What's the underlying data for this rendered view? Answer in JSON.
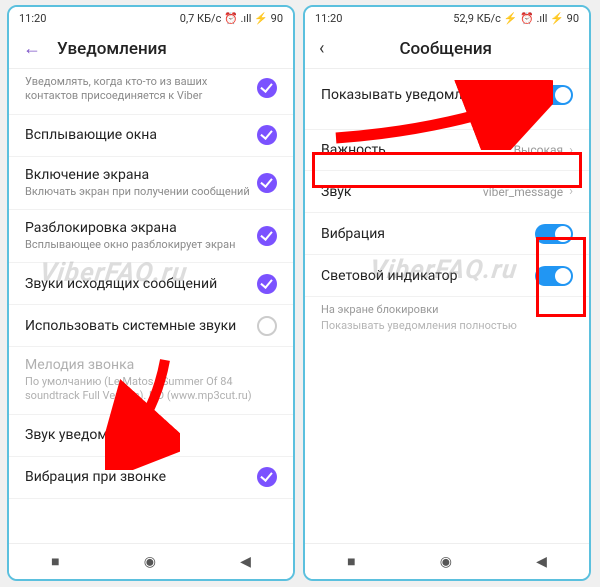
{
  "left": {
    "status": {
      "time": "11:20",
      "right": "0,7 КБ/с ⏰ .ıll ⚡ 90"
    },
    "header": {
      "title": "Уведомления"
    },
    "rows": [
      {
        "main": "",
        "sub": "Уведомлять, когда кто-то из ваших контактов присоединяется к Viber",
        "check": true,
        "clipped": true
      },
      {
        "main": "Всплывающие окна",
        "sub": "",
        "check": true
      },
      {
        "main": "Включение экрана",
        "sub": "Включать экран при получении сообщений",
        "check": true
      },
      {
        "main": "Разблокировка экрана",
        "sub": "Всплывающее окно разблокирует экран",
        "check": true
      },
      {
        "main": "Звуки исходящих сообщений",
        "sub": "",
        "check": true
      },
      {
        "main": "Использовать системные звуки",
        "sub": "",
        "circle": true
      },
      {
        "main": "Мелодия звонка",
        "sub": "По умолчанию (Le Matos - Summer Of 84 soundtrack Full Version). HD (www.mp3cut.ru)",
        "disabled": true
      },
      {
        "main": "Звук уведомления",
        "sub": ""
      },
      {
        "main": "Вибрация при звонке",
        "sub": "",
        "check": true
      }
    ]
  },
  "right": {
    "status": {
      "time": "11:20",
      "right": "52,9 КБ/с ⚡ ⏰ .ıll ⚡ 90"
    },
    "header": {
      "title": "Сообщения"
    },
    "rows": [
      {
        "main": "Показывать уведомления",
        "toggle": true
      },
      {
        "main": "Важность",
        "value": "Высокая",
        "chev": true
      },
      {
        "main": "Звук",
        "value": "viber_message",
        "chev": true
      },
      {
        "main": "Вибрация",
        "toggle": true
      },
      {
        "main": "Световой индикатор",
        "toggle": true
      }
    ],
    "lock": {
      "t": "На экране блокировки",
      "s": "Показывать уведомления полностью"
    }
  },
  "watermark": "ViberFAQ.ru",
  "nav": {
    "sq": "■",
    "ci": "◉",
    "tr": "◀"
  }
}
